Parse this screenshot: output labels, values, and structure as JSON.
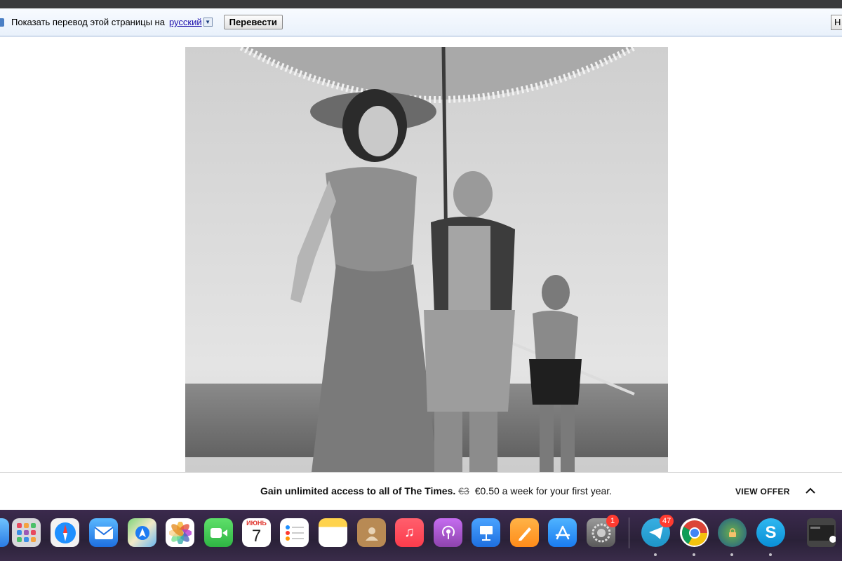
{
  "translate_bar": {
    "prompt": "Показать перевод этой страницы на",
    "language": "русский",
    "translate_button": "Перевести",
    "right_button": "Н"
  },
  "offer": {
    "headline": "Gain unlimited access to all of The Times.",
    "old_price": "€3",
    "price_text": "€0.50 a week for your first year.",
    "cta": "VIEW OFFER"
  },
  "dock": {
    "calendar_month": "ИЮНЬ",
    "calendar_day": "7",
    "system_prefs_badge": "1",
    "telegram_badge": "47",
    "apps": [
      "finder",
      "launchpad",
      "safari",
      "mail",
      "maps",
      "photos",
      "facetime",
      "calendar",
      "reminders",
      "notes",
      "contacts",
      "music",
      "podcasts",
      "keynote",
      "pages",
      "app-store",
      "system-preferences",
      "telegram",
      "chrome",
      "vpn",
      "skype",
      "screenshot-preview"
    ]
  },
  "colors": {
    "translate_bar_bg": "#eaf1fb",
    "dock_bg": "#2a2138",
    "badge": "#ff3b30",
    "link": "#1a0dab"
  }
}
